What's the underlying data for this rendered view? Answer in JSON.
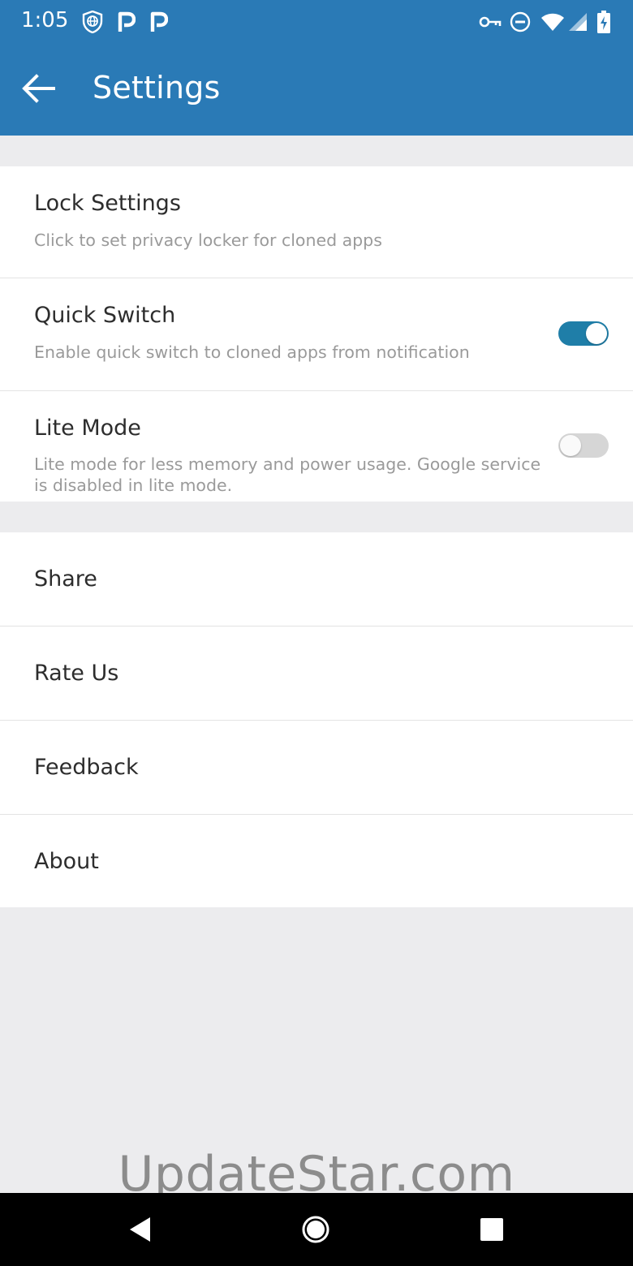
{
  "status_bar": {
    "time": "1:05",
    "left_icons": [
      "shield-globe-icon",
      "p-icon",
      "p-icon"
    ],
    "right_icons": [
      "vpn-key-icon",
      "do-not-disturb-icon",
      "wifi-icon",
      "cell-signal-icon",
      "battery-charging-icon"
    ]
  },
  "toolbar": {
    "title": "Settings",
    "back_icon": "arrow-left-icon",
    "background": "#2a7ab6"
  },
  "settings": {
    "lock": {
      "title": "Lock Settings",
      "subtitle": "Click to set privacy locker for cloned apps"
    },
    "quick_switch": {
      "title": "Quick Switch",
      "subtitle": "Enable quick switch to cloned apps from notification",
      "enabled": true
    },
    "lite_mode": {
      "title": "Lite Mode",
      "subtitle": "Lite mode for less memory and power usage. Google service is disabled in lite mode.",
      "enabled": false
    }
  },
  "more": {
    "share": "Share",
    "rate_us": "Rate Us",
    "feedback": "Feedback",
    "about": "About"
  },
  "watermark": "UpdateStar.com",
  "colors": {
    "accent": "#1f7ea8",
    "toggle_off": "#d6d6d6"
  },
  "nav_bar": {
    "icons": [
      "back-triangle-icon",
      "home-circle-icon",
      "recents-square-icon"
    ]
  }
}
